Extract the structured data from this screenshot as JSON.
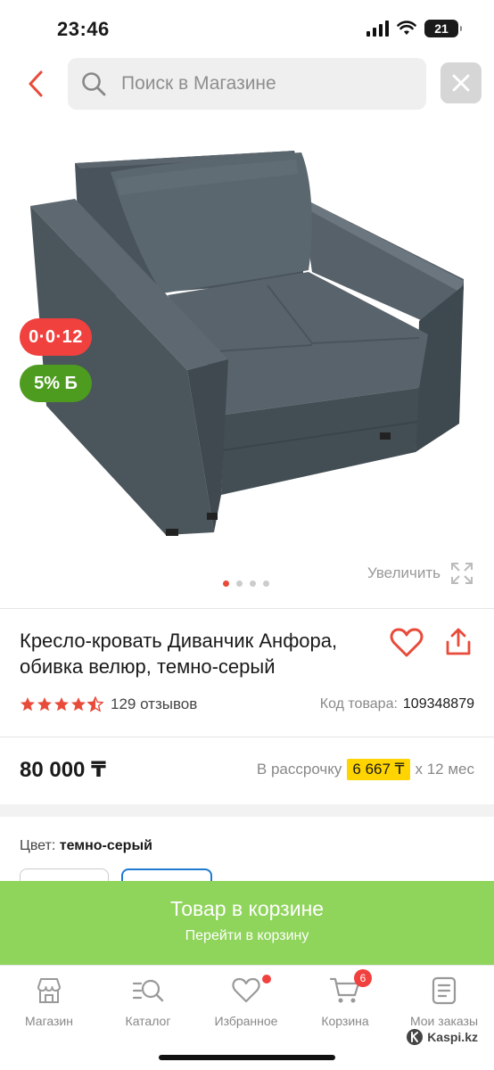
{
  "status_bar": {
    "time": "23:46",
    "battery": "21"
  },
  "search": {
    "placeholder": "Поиск в Магазине"
  },
  "badges": {
    "installment": "0·0·12",
    "bonus": "5% Б"
  },
  "gallery": {
    "zoom_label": "Увеличить",
    "total_images": 4,
    "current_image": 1
  },
  "product": {
    "title": "Кресло-кровать Диванчик Анфора, обивка велюр, темно-серый",
    "rating": 4.5,
    "reviews": "129 отзывов",
    "sku_label": "Код товара:",
    "sku": "109348879",
    "price": "80 000 ₸",
    "installment_prefix": "В рассрочку",
    "installment_amount": "6 667 ₸",
    "installment_suffix": "х 12 мес",
    "color_label": "Цвет:",
    "color_value": "темно-серый"
  },
  "cart_banner": {
    "title": "Товар в корзине",
    "subtitle": "Перейти в корзину"
  },
  "tabs": [
    {
      "label": "Магазин",
      "icon": "shop-icon"
    },
    {
      "label": "Каталог",
      "icon": "catalog-icon"
    },
    {
      "label": "Избранное",
      "icon": "heart-icon"
    },
    {
      "label": "Корзина",
      "icon": "cart-icon",
      "count": "6"
    },
    {
      "label": "Мои заказы",
      "icon": "orders-icon"
    }
  ],
  "brand": "Kaspi.kz",
  "colors": {
    "accent": "#e84b3a",
    "bonus_green": "#4d9c1f",
    "cart_green": "#8fd45b",
    "highlight": "#ffd400",
    "selected_blue": "#1f7ad0"
  }
}
